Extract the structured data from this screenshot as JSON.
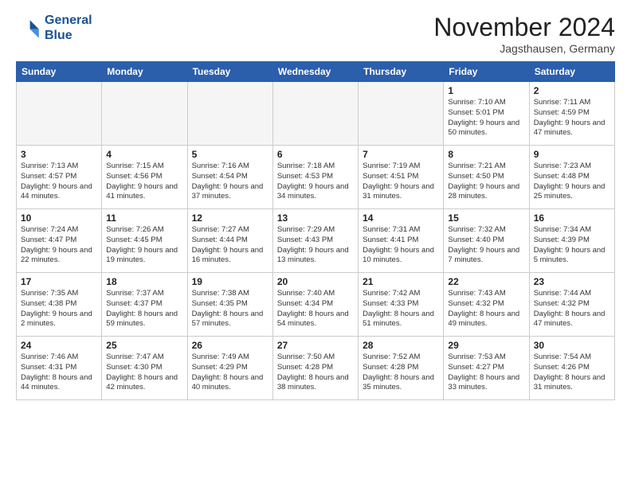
{
  "header": {
    "logo_line1": "General",
    "logo_line2": "Blue",
    "month": "November 2024",
    "location": "Jagsthausen, Germany"
  },
  "weekdays": [
    "Sunday",
    "Monday",
    "Tuesday",
    "Wednesday",
    "Thursday",
    "Friday",
    "Saturday"
  ],
  "weeks": [
    [
      {
        "day": "",
        "info": ""
      },
      {
        "day": "",
        "info": ""
      },
      {
        "day": "",
        "info": ""
      },
      {
        "day": "",
        "info": ""
      },
      {
        "day": "",
        "info": ""
      },
      {
        "day": "1",
        "info": "Sunrise: 7:10 AM\nSunset: 5:01 PM\nDaylight: 9 hours and 50 minutes."
      },
      {
        "day": "2",
        "info": "Sunrise: 7:11 AM\nSunset: 4:59 PM\nDaylight: 9 hours and 47 minutes."
      }
    ],
    [
      {
        "day": "3",
        "info": "Sunrise: 7:13 AM\nSunset: 4:57 PM\nDaylight: 9 hours and 44 minutes."
      },
      {
        "day": "4",
        "info": "Sunrise: 7:15 AM\nSunset: 4:56 PM\nDaylight: 9 hours and 41 minutes."
      },
      {
        "day": "5",
        "info": "Sunrise: 7:16 AM\nSunset: 4:54 PM\nDaylight: 9 hours and 37 minutes."
      },
      {
        "day": "6",
        "info": "Sunrise: 7:18 AM\nSunset: 4:53 PM\nDaylight: 9 hours and 34 minutes."
      },
      {
        "day": "7",
        "info": "Sunrise: 7:19 AM\nSunset: 4:51 PM\nDaylight: 9 hours and 31 minutes."
      },
      {
        "day": "8",
        "info": "Sunrise: 7:21 AM\nSunset: 4:50 PM\nDaylight: 9 hours and 28 minutes."
      },
      {
        "day": "9",
        "info": "Sunrise: 7:23 AM\nSunset: 4:48 PM\nDaylight: 9 hours and 25 minutes."
      }
    ],
    [
      {
        "day": "10",
        "info": "Sunrise: 7:24 AM\nSunset: 4:47 PM\nDaylight: 9 hours and 22 minutes."
      },
      {
        "day": "11",
        "info": "Sunrise: 7:26 AM\nSunset: 4:45 PM\nDaylight: 9 hours and 19 minutes."
      },
      {
        "day": "12",
        "info": "Sunrise: 7:27 AM\nSunset: 4:44 PM\nDaylight: 9 hours and 16 minutes."
      },
      {
        "day": "13",
        "info": "Sunrise: 7:29 AM\nSunset: 4:43 PM\nDaylight: 9 hours and 13 minutes."
      },
      {
        "day": "14",
        "info": "Sunrise: 7:31 AM\nSunset: 4:41 PM\nDaylight: 9 hours and 10 minutes."
      },
      {
        "day": "15",
        "info": "Sunrise: 7:32 AM\nSunset: 4:40 PM\nDaylight: 9 hours and 7 minutes."
      },
      {
        "day": "16",
        "info": "Sunrise: 7:34 AM\nSunset: 4:39 PM\nDaylight: 9 hours and 5 minutes."
      }
    ],
    [
      {
        "day": "17",
        "info": "Sunrise: 7:35 AM\nSunset: 4:38 PM\nDaylight: 9 hours and 2 minutes."
      },
      {
        "day": "18",
        "info": "Sunrise: 7:37 AM\nSunset: 4:37 PM\nDaylight: 8 hours and 59 minutes."
      },
      {
        "day": "19",
        "info": "Sunrise: 7:38 AM\nSunset: 4:35 PM\nDaylight: 8 hours and 57 minutes."
      },
      {
        "day": "20",
        "info": "Sunrise: 7:40 AM\nSunset: 4:34 PM\nDaylight: 8 hours and 54 minutes."
      },
      {
        "day": "21",
        "info": "Sunrise: 7:42 AM\nSunset: 4:33 PM\nDaylight: 8 hours and 51 minutes."
      },
      {
        "day": "22",
        "info": "Sunrise: 7:43 AM\nSunset: 4:32 PM\nDaylight: 8 hours and 49 minutes."
      },
      {
        "day": "23",
        "info": "Sunrise: 7:44 AM\nSunset: 4:32 PM\nDaylight: 8 hours and 47 minutes."
      }
    ],
    [
      {
        "day": "24",
        "info": "Sunrise: 7:46 AM\nSunset: 4:31 PM\nDaylight: 8 hours and 44 minutes."
      },
      {
        "day": "25",
        "info": "Sunrise: 7:47 AM\nSunset: 4:30 PM\nDaylight: 8 hours and 42 minutes."
      },
      {
        "day": "26",
        "info": "Sunrise: 7:49 AM\nSunset: 4:29 PM\nDaylight: 8 hours and 40 minutes."
      },
      {
        "day": "27",
        "info": "Sunrise: 7:50 AM\nSunset: 4:28 PM\nDaylight: 8 hours and 38 minutes."
      },
      {
        "day": "28",
        "info": "Sunrise: 7:52 AM\nSunset: 4:28 PM\nDaylight: 8 hours and 35 minutes."
      },
      {
        "day": "29",
        "info": "Sunrise: 7:53 AM\nSunset: 4:27 PM\nDaylight: 8 hours and 33 minutes."
      },
      {
        "day": "30",
        "info": "Sunrise: 7:54 AM\nSunset: 4:26 PM\nDaylight: 8 hours and 31 minutes."
      }
    ]
  ]
}
